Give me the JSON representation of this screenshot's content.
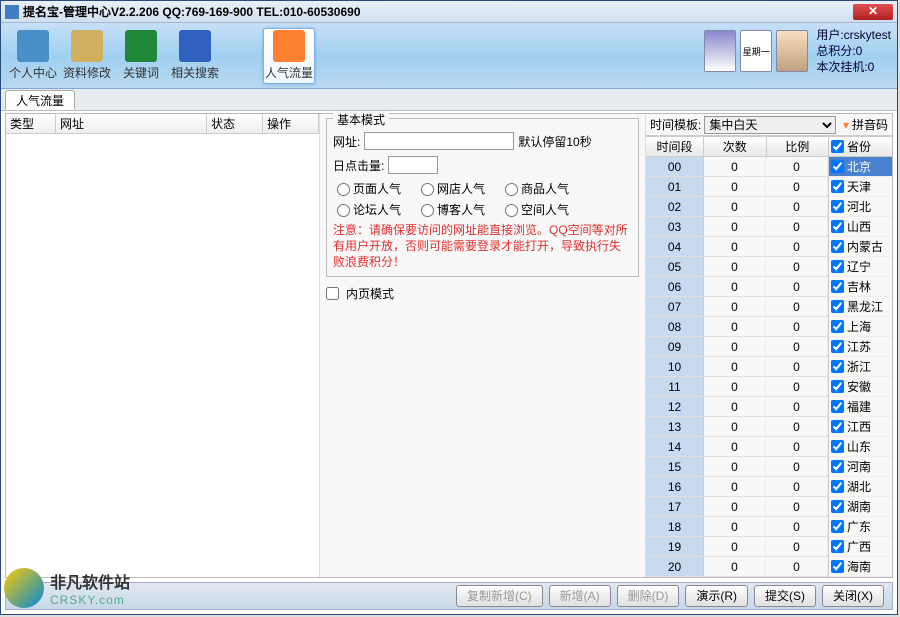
{
  "title": "提名宝-管理中心V2.2.206    QQ:769-169-900   TEL:010-60530690",
  "ribbon": [
    {
      "id": "personal",
      "label": "个人中心",
      "color": "#4a90c8"
    },
    {
      "id": "datamod",
      "label": "资料修改",
      "color": "#d0b060"
    },
    {
      "id": "keyword",
      "label": "关键词",
      "color": "#208838"
    },
    {
      "id": "relsearch",
      "label": "相关搜索",
      "color": "#3060c0"
    },
    {
      "id": "traffic",
      "label": "人气流量",
      "color": "#ff8030",
      "active": true
    }
  ],
  "user": {
    "line1": "用户:crskytest",
    "line2": "总积分:0",
    "line3": "本次挂机:0",
    "week": "星期一"
  },
  "page_tab": "人气流量",
  "left_columns": [
    "类型",
    "网址",
    "状态",
    "操作"
  ],
  "basic": {
    "legend": "基本模式",
    "url_label": "网址:",
    "url_note": "默认停留10秒",
    "click_label": "日点击量:",
    "radios_row1": [
      "页面人气",
      "网店人气",
      "商品人气"
    ],
    "radios_row2": [
      "论坛人气",
      "博客人气",
      "空间人气"
    ],
    "warning": "注意：请确保要访问的网址能直接浏览。QQ空间等对所有用户开放，否则可能需要登录才能打开，导致执行失败浪费积分！"
  },
  "inner_mode": "内页模式",
  "time": {
    "label": "时间模板:",
    "template": "集中白天",
    "py_label": "拼音码",
    "cols": [
      "时间段",
      "次数",
      "比例"
    ],
    "rows": [
      [
        "00",
        "0",
        "0"
      ],
      [
        "01",
        "0",
        "0"
      ],
      [
        "02",
        "0",
        "0"
      ],
      [
        "03",
        "0",
        "0"
      ],
      [
        "04",
        "0",
        "0"
      ],
      [
        "05",
        "0",
        "0"
      ],
      [
        "06",
        "0",
        "0"
      ],
      [
        "07",
        "0",
        "0"
      ],
      [
        "08",
        "0",
        "0"
      ],
      [
        "09",
        "0",
        "0"
      ],
      [
        "10",
        "0",
        "0"
      ],
      [
        "11",
        "0",
        "0"
      ],
      [
        "12",
        "0",
        "0"
      ],
      [
        "13",
        "0",
        "0"
      ],
      [
        "14",
        "0",
        "0"
      ],
      [
        "15",
        "0",
        "0"
      ],
      [
        "16",
        "0",
        "0"
      ],
      [
        "17",
        "0",
        "0"
      ],
      [
        "18",
        "0",
        "0"
      ],
      [
        "19",
        "0",
        "0"
      ],
      [
        "20",
        "0",
        "0"
      ]
    ]
  },
  "provinces": {
    "header": "省份",
    "items": [
      "北京",
      "天津",
      "河北",
      "山西",
      "内蒙古",
      "辽宁",
      "吉林",
      "黑龙江",
      "上海",
      "江苏",
      "浙江",
      "安徽",
      "福建",
      "江西",
      "山东",
      "河南",
      "湖北",
      "湖南",
      "广东",
      "广西",
      "海南"
    ]
  },
  "footer": {
    "copy": "复制新增(C)",
    "new": "新增(A)",
    "del": "删除(D)",
    "demo": "演示(R)",
    "submit": "提交(S)",
    "close": "关闭(X)"
  },
  "watermark": {
    "cn": "非凡软件站",
    "en": "CRSKY.com"
  }
}
